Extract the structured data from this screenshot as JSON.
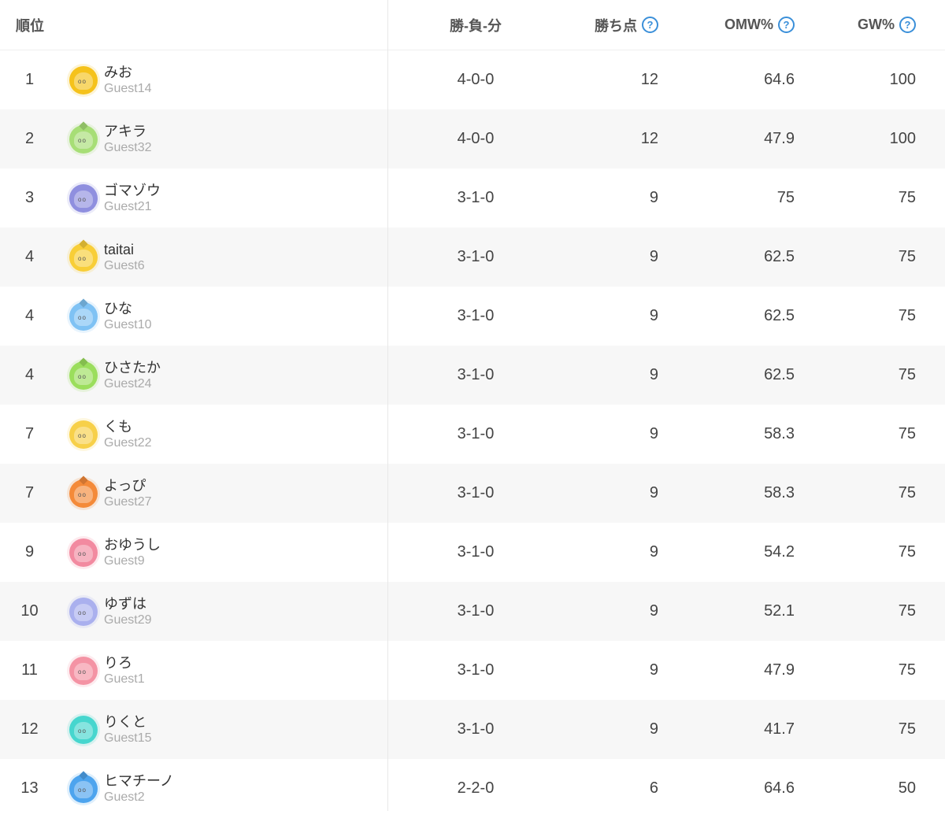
{
  "header": {
    "rank": "順位",
    "wld": "勝-負-分",
    "points": "勝ち点",
    "omw": "OMW%",
    "gw": "GW%",
    "help_glyph": "?"
  },
  "colors": {
    "help_accent": "#3a8fd9",
    "row_alt": "#f7f7f7"
  },
  "rows": [
    {
      "rank": "1",
      "name": "みお",
      "guest": "Guest14",
      "wld": "4-0-0",
      "points": "12",
      "omw": "64.6",
      "gw": "100",
      "avatar_color": "#f6c21c",
      "tuft": false
    },
    {
      "rank": "2",
      "name": "アキラ",
      "guest": "Guest32",
      "wld": "4-0-0",
      "points": "12",
      "omw": "47.9",
      "gw": "100",
      "avatar_color": "#a8df77",
      "tuft": true
    },
    {
      "rank": "3",
      "name": "ゴマゾウ",
      "guest": "Guest21",
      "wld": "3-1-0",
      "points": "9",
      "omw": "75",
      "gw": "75",
      "avatar_color": "#8f8fe0",
      "tuft": false
    },
    {
      "rank": "4",
      "name": "taitai",
      "guest": "Guest6",
      "wld": "3-1-0",
      "points": "9",
      "omw": "62.5",
      "gw": "75",
      "avatar_color": "#f8cf38",
      "tuft": true
    },
    {
      "rank": "4",
      "name": "ひな",
      "guest": "Guest10",
      "wld": "3-1-0",
      "points": "9",
      "omw": "62.5",
      "gw": "75",
      "avatar_color": "#7fc3f4",
      "tuft": true
    },
    {
      "rank": "4",
      "name": "ひさたか",
      "guest": "Guest24",
      "wld": "3-1-0",
      "points": "9",
      "omw": "62.5",
      "gw": "75",
      "avatar_color": "#9bde5c",
      "tuft": true
    },
    {
      "rank": "7",
      "name": "くも",
      "guest": "Guest22",
      "wld": "3-1-0",
      "points": "9",
      "omw": "58.3",
      "gw": "75",
      "avatar_color": "#f7d04a",
      "tuft": false
    },
    {
      "rank": "7",
      "name": "よっぴ",
      "guest": "Guest27",
      "wld": "3-1-0",
      "points": "9",
      "omw": "58.3",
      "gw": "75",
      "avatar_color": "#f58a3a",
      "tuft": true
    },
    {
      "rank": "9",
      "name": "おゆうし",
      "guest": "Guest9",
      "wld": "3-1-0",
      "points": "9",
      "omw": "54.2",
      "gw": "75",
      "avatar_color": "#f28aa0",
      "tuft": false
    },
    {
      "rank": "10",
      "name": "ゆずは",
      "guest": "Guest29",
      "wld": "3-1-0",
      "points": "9",
      "omw": "52.1",
      "gw": "75",
      "avatar_color": "#aab0ee",
      "tuft": false
    },
    {
      "rank": "11",
      "name": "りろ",
      "guest": "Guest1",
      "wld": "3-1-0",
      "points": "9",
      "omw": "47.9",
      "gw": "75",
      "avatar_color": "#f593a4",
      "tuft": false
    },
    {
      "rank": "12",
      "name": "りくと",
      "guest": "Guest15",
      "wld": "3-1-0",
      "points": "9",
      "omw": "41.7",
      "gw": "75",
      "avatar_color": "#46d6cf",
      "tuft": false
    },
    {
      "rank": "13",
      "name": "ヒマチーノ",
      "guest": "Guest2",
      "wld": "2-2-0",
      "points": "6",
      "omw": "64.6",
      "gw": "50",
      "avatar_color": "#4ea4ee",
      "tuft": true
    }
  ]
}
